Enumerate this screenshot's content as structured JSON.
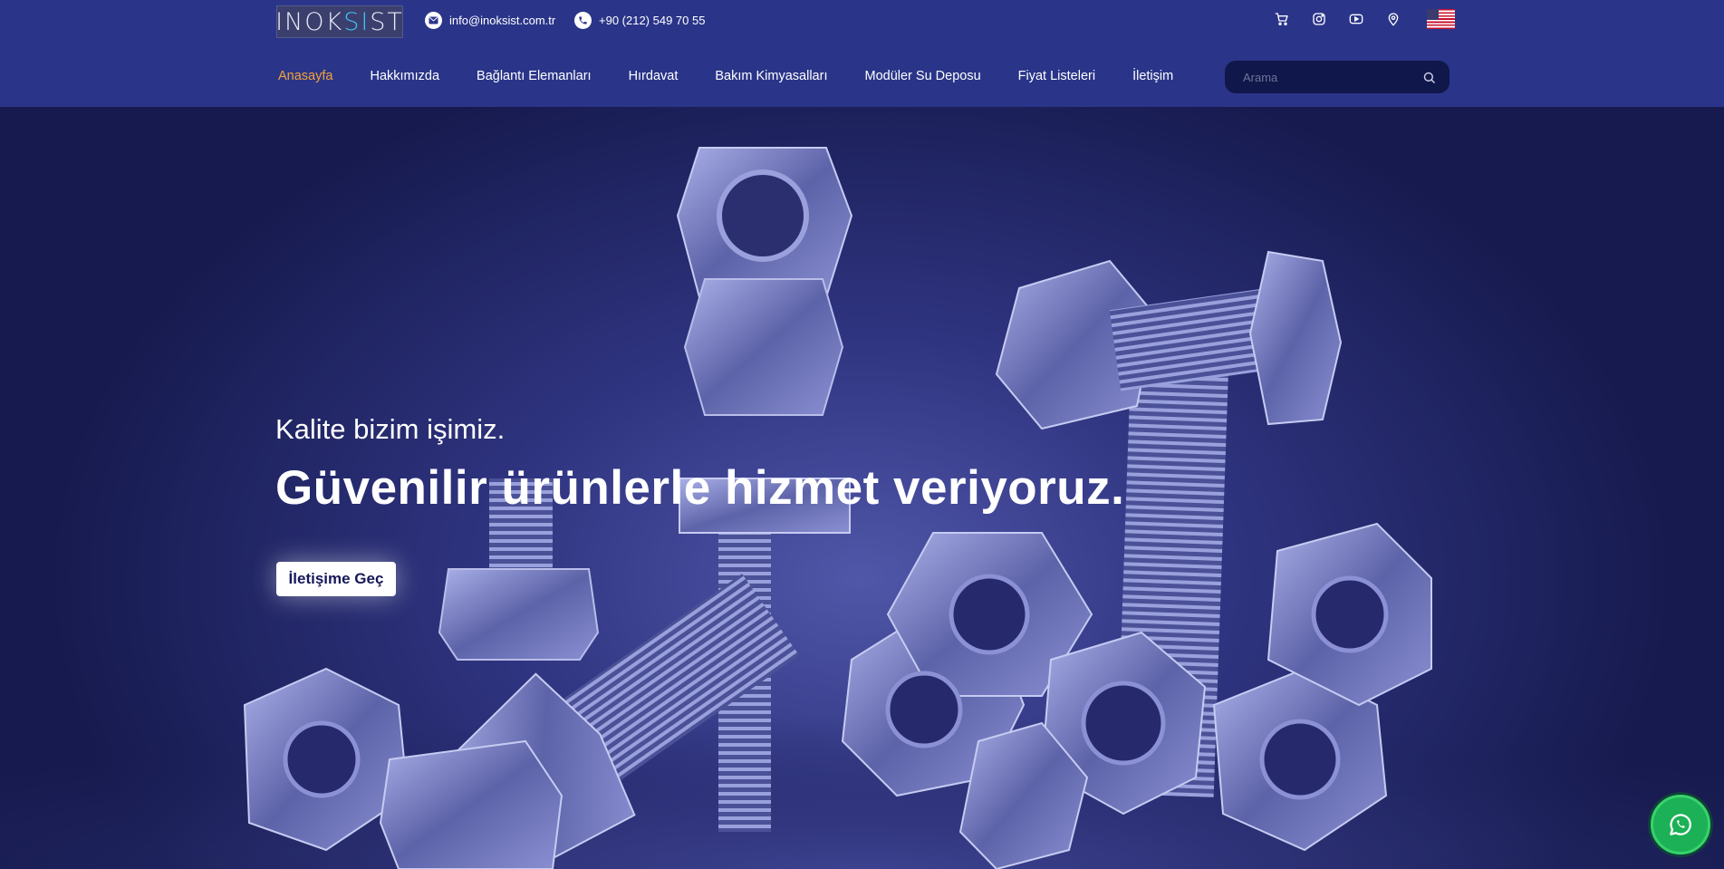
{
  "header": {
    "logo": {
      "pre": "INOK",
      "hl": "SI",
      "post": "ST"
    },
    "email": "info@inoksist.com.tr",
    "phone": "+90 (212) 549 70 55",
    "icons": [
      "cart-icon",
      "instagram-icon",
      "youtube-icon",
      "location-icon",
      "us-flag-icon"
    ]
  },
  "nav": {
    "items": [
      {
        "label": "Anasayfa",
        "active": true
      },
      {
        "label": "Hakkımızda"
      },
      {
        "label": "Bağlantı Elemanları"
      },
      {
        "label": "Hırdavat"
      },
      {
        "label": "Bakım Kimyasalları"
      },
      {
        "label": "Modüler Su Deposu"
      },
      {
        "label": "Fiyat Listeleri"
      },
      {
        "label": "İletişim"
      }
    ]
  },
  "search": {
    "placeholder": "Arama"
  },
  "hero": {
    "subtitle": "Kalite bizim işimiz.",
    "title": "Güvenilir ürünlerle hizmet veriyoruz.",
    "cta": "İletişime Geç"
  },
  "colors": {
    "header_bg": "#2a3589",
    "active_nav": "#f2a23b",
    "hero_tint": "#2f3480",
    "whatsapp": "#1cb156"
  }
}
